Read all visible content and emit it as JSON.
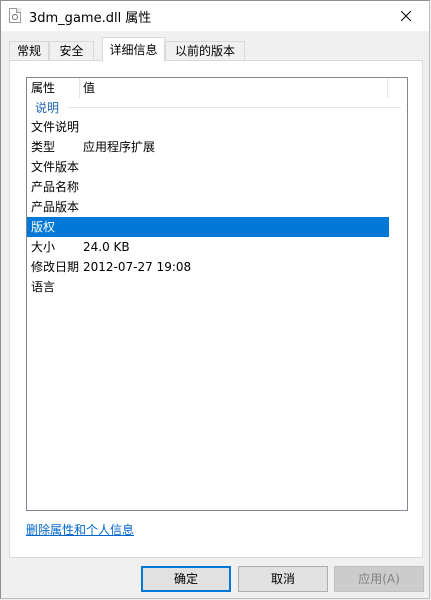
{
  "window": {
    "title": "3dm_game.dll 属性",
    "close_icon": "close-icon",
    "file_icon": "dll-file-icon"
  },
  "tabs": [
    {
      "label": "常规",
      "active": false
    },
    {
      "label": "安全",
      "active": false
    },
    {
      "label": "详细信息",
      "active": true
    },
    {
      "label": "以前的版本",
      "active": false
    }
  ],
  "details": {
    "columns": {
      "property": "属性",
      "value": "值"
    },
    "group": "说明",
    "rows": [
      {
        "name": "文件说明",
        "value": ""
      },
      {
        "name": "类型",
        "value": "应用程序扩展"
      },
      {
        "name": "文件版本",
        "value": ""
      },
      {
        "name": "产品名称",
        "value": ""
      },
      {
        "name": "产品版本",
        "value": ""
      },
      {
        "name": "版权",
        "value": "",
        "selected": true
      },
      {
        "name": "大小",
        "value": "24.0 KB"
      },
      {
        "name": "修改日期",
        "value": "2012-07-27 19:08"
      },
      {
        "name": "语言",
        "value": ""
      }
    ],
    "selection_color": "#0078d7"
  },
  "remove_link": "删除属性和个人信息",
  "buttons": {
    "ok": "确定",
    "cancel": "取消",
    "apply": "应用(A)"
  }
}
